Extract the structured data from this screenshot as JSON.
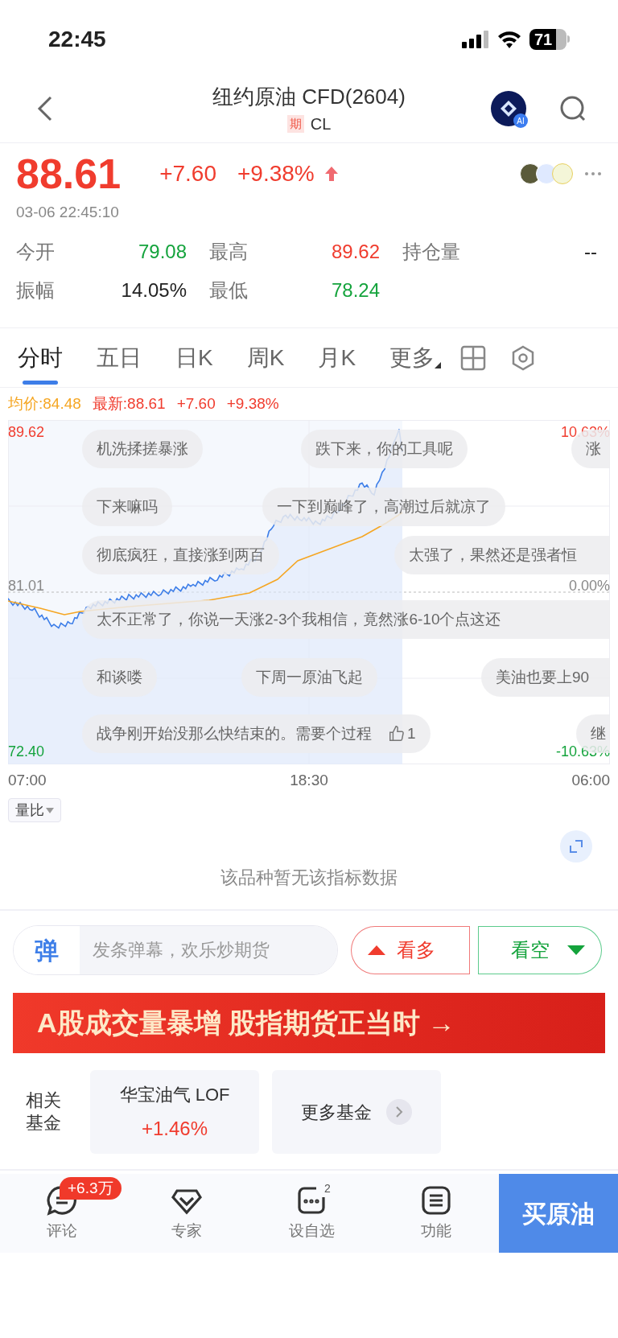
{
  "status_bar": {
    "time": "22:45",
    "battery": "71"
  },
  "header": {
    "title": "纽约原油 CFD(2604)",
    "tag": "期",
    "symbol": "CL",
    "ai_badge": "AI"
  },
  "quote": {
    "price": "88.61",
    "change": "+7.60",
    "change_pct": "+9.38%",
    "timestamp": "03-06 22:45:10",
    "stats": [
      {
        "label": "今开",
        "value": "79.08",
        "color": "#14a33c"
      },
      {
        "label": "最高",
        "value": "89.62",
        "color": "#f03c2e"
      },
      {
        "label": "持仓量",
        "value": "--",
        "color": "#222222"
      },
      {
        "label": "振幅",
        "value": "14.05%",
        "color": "#222222"
      },
      {
        "label": "最低",
        "value": "78.24",
        "color": "#14a33c"
      }
    ]
  },
  "tabs": [
    {
      "label": "分时",
      "selected": true
    },
    {
      "label": "五日",
      "selected": false
    },
    {
      "label": "日K",
      "selected": false
    },
    {
      "label": "周K",
      "selected": false
    },
    {
      "label": "月K",
      "selected": false
    },
    {
      "label": "更多",
      "selected": false,
      "kind": "menu"
    }
  ],
  "info_line": {
    "avg": "均价:84.48",
    "latest": "最新:88.61",
    "change": "+7.60",
    "change_pct": "+9.38%"
  },
  "chart": {
    "left_labels": [
      "89.62",
      "81.01",
      "72.40"
    ],
    "right_labels": [
      "10.63%",
      "0.00%",
      "-10.63%"
    ],
    "time_labels": [
      "07:00",
      "18:30",
      "06:00"
    ],
    "danmaku": [
      {
        "text": "机洗揉搓暴涨"
      },
      {
        "text": "跌下来，你的工具呢"
      },
      {
        "text": "涨"
      },
      {
        "text": "下来嘛吗"
      },
      {
        "text": "一下到巅峰了，高潮过后就凉了"
      },
      {
        "text": "彻底疯狂，直接涨到两百"
      },
      {
        "text": "太强了，果然还是强者恒"
      },
      {
        "text": "太不正常了，你说一天涨2-3个我相信，竟然涨6-10个点这还"
      },
      {
        "text": "和谈喽"
      },
      {
        "text": "下周一原油飞起"
      },
      {
        "text": "美油也要上90"
      },
      {
        "text": "战争刚开始没那么快结束的。需要个过程",
        "likes": "1"
      },
      {
        "text": "继"
      }
    ]
  },
  "indicator": {
    "selector": "量比",
    "empty_text": "该品种暂无该指标数据"
  },
  "comment_bar": {
    "badge": "弹",
    "placeholder": "发条弹幕，欢乐炒期货",
    "bull": "看多",
    "bear": "看空"
  },
  "banner": {
    "text": "A股成交量暴增 股指期货正当时 →"
  },
  "funds": {
    "label": "相关基金",
    "items": [
      {
        "name": "华宝油气 LOF",
        "change": "+1.46%"
      }
    ],
    "more": "更多基金"
  },
  "bottom_nav": {
    "items": [
      {
        "label": "评论",
        "badge": "+6.3万",
        "kind": "comment"
      },
      {
        "label": "专家",
        "kind": "expert"
      },
      {
        "label": "设自选",
        "count": "2",
        "kind": "watch"
      },
      {
        "label": "功能",
        "kind": "menu"
      }
    ],
    "buy": "买原油"
  }
}
